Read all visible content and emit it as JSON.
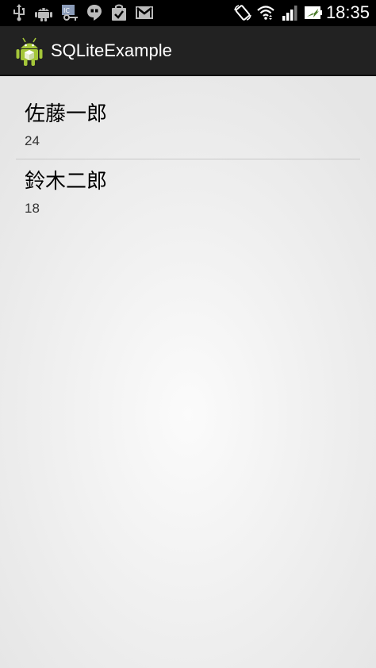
{
  "status_bar": {
    "time": "18:35",
    "left_icons": [
      "usb-icon",
      "android-debug-icon",
      "ic-key-icon",
      "hangouts-icon",
      "play-store-icon",
      "gmail-icon"
    ],
    "right_icons": [
      "auto-rotate-icon",
      "wifi-icon",
      "signal-icon",
      "battery-icon"
    ]
  },
  "action_bar": {
    "title": "SQLiteExample",
    "icon": "android-app-icon"
  },
  "list": {
    "items": [
      {
        "name": "佐藤一郎",
        "age": "24"
      },
      {
        "name": "鈴木二郎",
        "age": "18"
      }
    ]
  },
  "colors": {
    "status_bar_bg": "#000000",
    "action_bar_bg": "#222222",
    "android_green": "#a4c639",
    "divider": "#c8c8c8"
  }
}
